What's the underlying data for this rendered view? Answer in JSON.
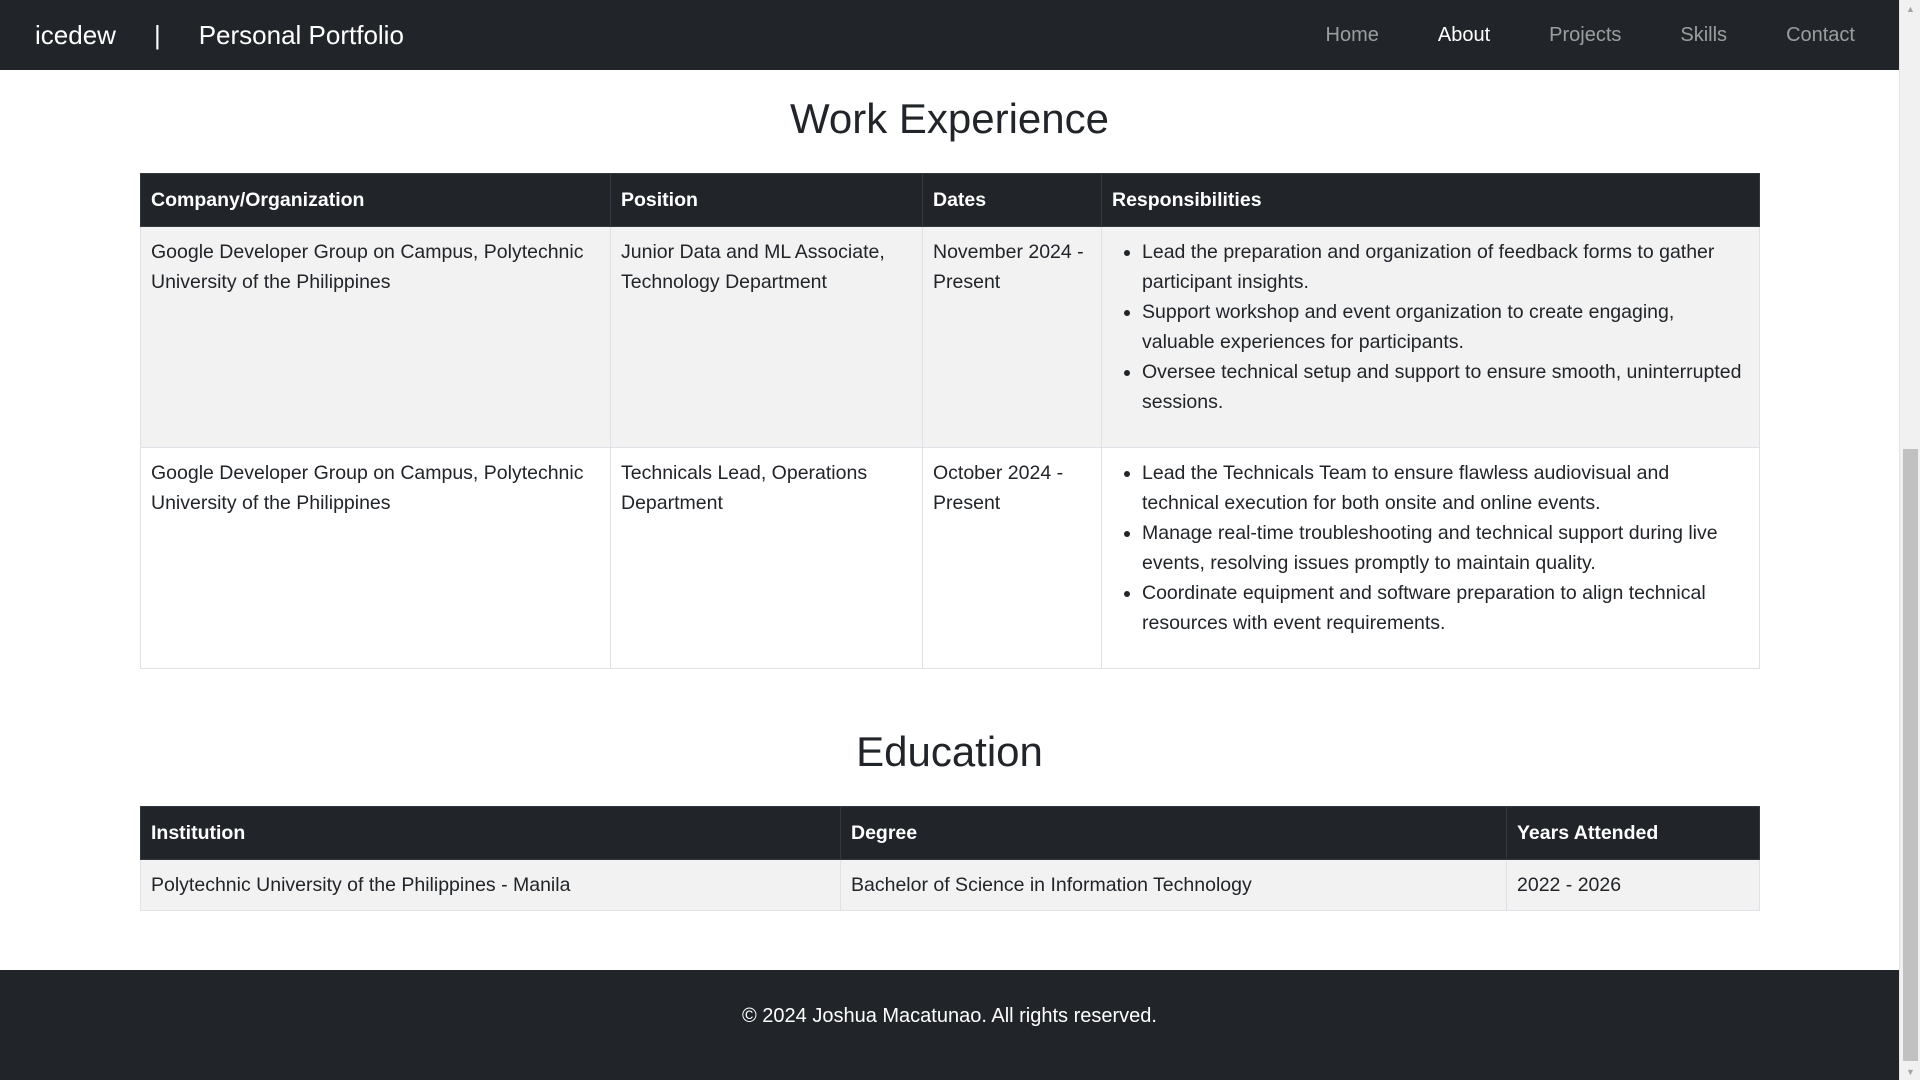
{
  "navbar": {
    "brand_name": "icedew",
    "brand_separator": "|",
    "brand_subtitle": "Personal Portfolio",
    "links": [
      {
        "label": "Home",
        "active": false
      },
      {
        "label": "About",
        "active": true
      },
      {
        "label": "Projects",
        "active": false
      },
      {
        "label": "Skills",
        "active": false
      },
      {
        "label": "Contact",
        "active": false
      }
    ]
  },
  "work": {
    "title": "Work Experience",
    "headers": [
      "Company/Organization",
      "Position",
      "Dates",
      "Responsibilities"
    ],
    "rows": [
      {
        "company": "Google Developer Group on Campus, Polytechnic University of the Philippines",
        "position": "Junior Data and ML Associate, Technology Department",
        "dates": "November 2024 - Present",
        "responsibilities": [
          "Lead the preparation and organization of feedback forms to gather participant insights.",
          "Support workshop and event organization to create engaging, valuable experiences for participants.",
          "Oversee technical setup and support to ensure smooth, uninterrupted sessions."
        ]
      },
      {
        "company": "Google Developer Group on Campus, Polytechnic University of the Philippines",
        "position": "Technicals Lead, Operations Department",
        "dates": "October 2024 - Present",
        "responsibilities": [
          "Lead the Technicals Team to ensure flawless audiovisual and technical execution for both onsite and online events.",
          "Manage real-time troubleshooting and technical support during live events, resolving issues promptly to maintain quality.",
          "Coordinate equipment and software preparation to align technical resources with event requirements."
        ]
      }
    ]
  },
  "education": {
    "title": "Education",
    "headers": [
      "Institution",
      "Degree",
      "Years Attended"
    ],
    "rows": [
      {
        "institution": "Polytechnic University of the Philippines - Manila",
        "degree": "Bachelor of Science in Information Technology",
        "years": "2022 - 2026"
      }
    ]
  },
  "footer": {
    "text": "© 2024 Joshua Macatunao. All rights reserved."
  },
  "colors": {
    "dark": "#212529",
    "stripe": "#f2f2f2",
    "border": "#dee2e6"
  }
}
